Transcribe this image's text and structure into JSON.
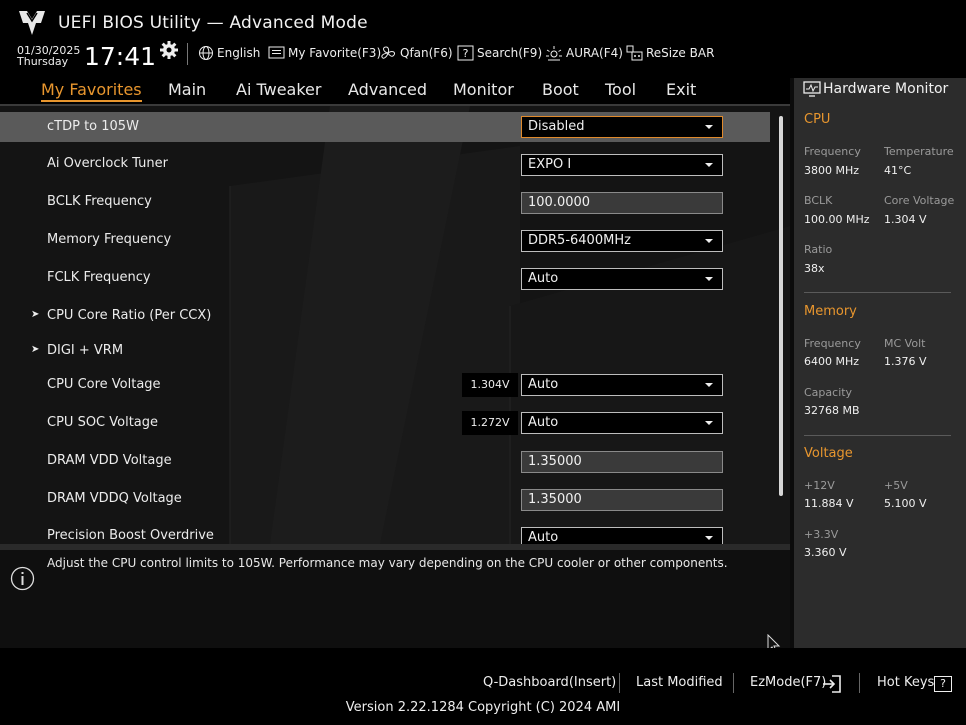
{
  "header": {
    "title": "UEFI BIOS Utility — Advanced Mode",
    "date": "01/30/2025",
    "day": "Thursday",
    "time": "17:41",
    "toolbar": [
      {
        "label": "English",
        "icon": "globe-icon"
      },
      {
        "label": "My Favorite(F3)",
        "icon": "favorite-icon"
      },
      {
        "label": "Qfan(F6)",
        "icon": "fan-icon"
      },
      {
        "label": "Search(F9)",
        "icon": "search-icon"
      },
      {
        "label": "AURA(F4)",
        "icon": "aura-icon"
      },
      {
        "label": "ReSize BAR",
        "icon": "resize-bar-icon"
      }
    ]
  },
  "nav": {
    "tabs": [
      "My Favorites",
      "Main",
      "Ai Tweaker",
      "Advanced",
      "Monitor",
      "Boot",
      "Tool",
      "Exit"
    ],
    "active": "My Favorites"
  },
  "settings": [
    {
      "label": "cTDP to 105W",
      "value": "Disabled",
      "type": "dropdown",
      "selected": true
    },
    {
      "label": "Ai Overclock Tuner",
      "value": "EXPO I",
      "type": "dropdown"
    },
    {
      "label": "BCLK Frequency",
      "value": "100.0000",
      "type": "input"
    },
    {
      "label": "Memory Frequency",
      "value": "DDR5-6400MHz",
      "type": "dropdown"
    },
    {
      "label": "FCLK Frequency",
      "value": "Auto",
      "type": "dropdown"
    },
    {
      "label": "CPU Core Ratio (Per CCX)",
      "type": "submenu"
    },
    {
      "label": "DIGI + VRM",
      "type": "submenu"
    },
    {
      "label": "CPU Core Voltage",
      "value": "Auto",
      "type": "dropdown",
      "reading": "1.304V"
    },
    {
      "label": "CPU SOC Voltage",
      "value": "Auto",
      "type": "dropdown",
      "reading": "1.272V"
    },
    {
      "label": "DRAM VDD Voltage",
      "value": "1.35000",
      "type": "input"
    },
    {
      "label": "DRAM VDDQ Voltage",
      "value": "1.35000",
      "type": "input"
    },
    {
      "label": "Precision Boost Overdrive",
      "value": "Auto",
      "type": "dropdown"
    }
  ],
  "help_text": "Adjust the CPU control limits to 105W. Performance may vary depending on the CPU cooler or other components.",
  "hardware_monitor": {
    "title": "Hardware Monitor",
    "cpu": {
      "section": "CPU",
      "frequency_label": "Frequency",
      "frequency": "3800 MHz",
      "temperature_label": "Temperature",
      "temperature": "41°C",
      "bclk_label": "BCLK",
      "bclk": "100.00 MHz",
      "core_voltage_label": "Core Voltage",
      "core_voltage": "1.304 V",
      "ratio_label": "Ratio",
      "ratio": "38x"
    },
    "memory": {
      "section": "Memory",
      "frequency_label": "Frequency",
      "frequency": "6400 MHz",
      "mc_volt_label": "MC Volt",
      "mc_volt": "1.376 V",
      "capacity_label": "Capacity",
      "capacity": "32768 MB"
    },
    "voltage": {
      "section": "Voltage",
      "v12_label": "+12V",
      "v12": "11.884 V",
      "v5_label": "+5V",
      "v5": "5.100 V",
      "v33_label": "+3.3V",
      "v33": "3.360 V"
    }
  },
  "footer": {
    "q_dashboard": "Q-Dashboard(Insert)",
    "last_modified": "Last Modified",
    "ezmode": "EzMode(F7)",
    "hotkeys": "Hot Keys",
    "hotkeys_glyph": "?",
    "version": "Version 2.22.1284 Copyright (C) 2024 AMI"
  },
  "colors": {
    "accent": "#e8962e",
    "selected_row": "#5a5a5a",
    "panel": "#2c2c2c"
  }
}
